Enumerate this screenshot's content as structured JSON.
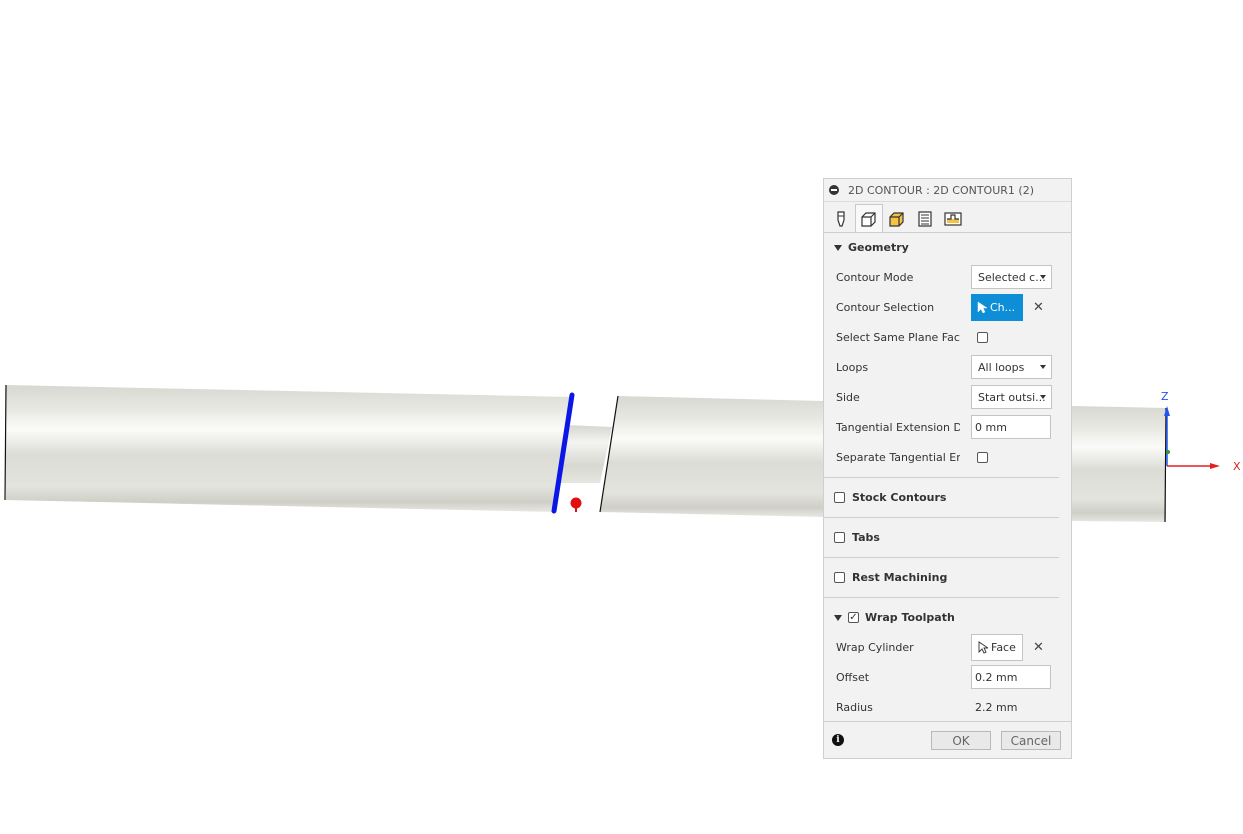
{
  "panel": {
    "title": "2D CONTOUR : 2D CONTOUR1 (2)",
    "tabs": [
      {
        "icon": "tool-icon",
        "active": false
      },
      {
        "icon": "geometry-icon",
        "active": true
      },
      {
        "icon": "heights-icon",
        "active": false
      },
      {
        "icon": "passes-icon",
        "active": false
      },
      {
        "icon": "linking-icon",
        "active": false
      }
    ],
    "geometry": {
      "header": "Geometry",
      "contour_mode_label": "Contour Mode",
      "contour_mode_value": "Selected c...",
      "contour_selection_label": "Contour Selection",
      "contour_selection_button": "Ch...",
      "select_same_plane_label": "Select Same Plane Fac...",
      "select_same_plane_checked": false,
      "loops_label": "Loops",
      "loops_value": "All loops",
      "side_label": "Side",
      "side_value": "Start outsi...",
      "tangential_ext_label": "Tangential Extension D...",
      "tangential_ext_value": "0 mm",
      "separate_tangential_label": "Separate Tangential En...",
      "separate_tangential_checked": false
    },
    "stock_contours": {
      "label": "Stock Contours",
      "checked": false
    },
    "tabs_section": {
      "label": "Tabs",
      "checked": false
    },
    "rest_machining": {
      "label": "Rest Machining",
      "checked": false
    },
    "wrap_toolpath": {
      "label": "Wrap Toolpath",
      "checked": true,
      "wrap_cylinder_label": "Wrap Cylinder",
      "wrap_cylinder_button": "Face",
      "offset_label": "Offset",
      "offset_value": "0.2 mm",
      "radius_label": "Radius",
      "radius_value": "2.2 mm"
    },
    "footer": {
      "ok_label": "OK",
      "cancel_label": "Cancel"
    }
  },
  "viewport": {
    "axis_z_label": "Z",
    "axis_x_label": "X",
    "colors": {
      "axis_z": "#2255ee",
      "axis_x": "#e02020",
      "selection": "#0a17e6",
      "marker": "#e01010",
      "accent": "#0e8ed6"
    }
  }
}
